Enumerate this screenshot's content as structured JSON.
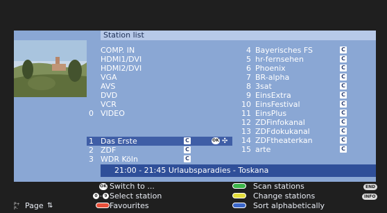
{
  "title": "Station list",
  "left_col": [
    {
      "num": "",
      "name": "COMP. IN"
    },
    {
      "num": "",
      "name": "HDMI1/DVI"
    },
    {
      "num": "",
      "name": "HDMI2/DVI"
    },
    {
      "num": "",
      "name": "VGA"
    },
    {
      "num": "",
      "name": "AVS"
    },
    {
      "num": "",
      "name": "DVD"
    },
    {
      "num": "",
      "name": "VCR"
    },
    {
      "num": "0",
      "name": "VIDEO"
    }
  ],
  "left_tv": [
    {
      "num": "1",
      "name": "Das Erste",
      "badge": "C",
      "selected": true
    },
    {
      "num": "2",
      "name": "ZDF",
      "badge": "C"
    },
    {
      "num": "3",
      "name": "WDR Köln",
      "badge": "C"
    }
  ],
  "right_col": [
    {
      "num": "4",
      "name": "Bayerisches FS",
      "badge": "C"
    },
    {
      "num": "5",
      "name": "hr-fernsehen",
      "badge": "C"
    },
    {
      "num": "6",
      "name": "Phoenix",
      "badge": "C"
    },
    {
      "num": "7",
      "name": "BR-alpha",
      "badge": "C"
    },
    {
      "num": "8",
      "name": "3sat",
      "badge": "C"
    },
    {
      "num": "9",
      "name": "EinsExtra",
      "badge": "C"
    },
    {
      "num": "10",
      "name": "EinsFestival",
      "badge": "C"
    },
    {
      "num": "11",
      "name": "EinsPlus",
      "badge": "C"
    },
    {
      "num": "12",
      "name": "ZDFinfokanal",
      "badge": "C"
    },
    {
      "num": "13",
      "name": "ZDFdokukanal",
      "badge": "C"
    },
    {
      "num": "14",
      "name": "ZDFtheaterkan",
      "badge": "C"
    },
    {
      "num": "15",
      "name": "arte",
      "badge": "C"
    }
  ],
  "ok_label": "OK",
  "epg": "21:00 - 21:45  Urlaubsparadies - Toskana",
  "footer": {
    "switch_to": "Switch to ...",
    "select_station": "Select station",
    "favourites": "Favourites",
    "scan_stations": "Scan stations",
    "change_stations": "Change stations",
    "sort": "Sort alphabetically",
    "page": "Page",
    "key_0": "0",
    "key_9": "9",
    "end_key": "END",
    "info_key": "INFO",
    "ok_key": "OK"
  },
  "colors": {
    "panel": "#8aa7d4",
    "title_bar": "#b7c9e8",
    "selection": "#3f5ea6",
    "epg_bar": "#2f4f99",
    "red": "#e8503a",
    "green": "#3cb54a",
    "yellow": "#e2dc3a",
    "blue": "#3a66c8"
  }
}
